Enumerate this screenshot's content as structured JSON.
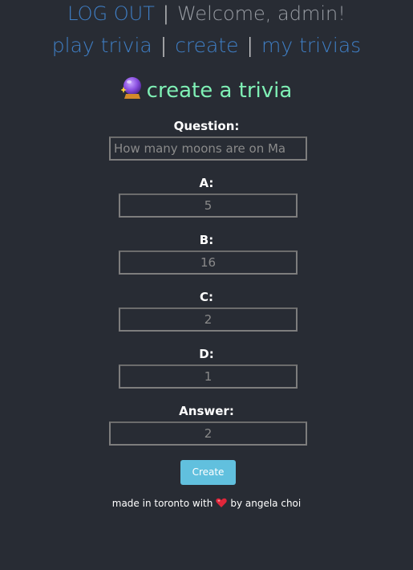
{
  "nav": {
    "logout_label": "LOG OUT",
    "separator": "|",
    "welcome_text": "Welcome, admin!",
    "play_label": "play trivia",
    "create_label": "create",
    "my_trivias_label": "my trivias"
  },
  "page": {
    "title": "create a trivia"
  },
  "form": {
    "question_label": "Question:",
    "question_value": "How many moons are on Ma",
    "a_label": "A:",
    "a_value": "5",
    "b_label": "B:",
    "b_value": "16",
    "c_label": "C:",
    "c_value": "2",
    "d_label": "D:",
    "d_value": "1",
    "answer_label": "Answer:",
    "answer_value": "2",
    "submit_label": "Create"
  },
  "footer": {
    "prefix": "made in toronto with",
    "suffix": "by angela choi"
  },
  "icons": {
    "title_icon": "crystal-ball-icon",
    "footer_icon": "heart-icon"
  },
  "colors": {
    "background": "#282c34",
    "link": "#3f7fc6",
    "title": "#7ff0b5",
    "button": "#61c0de"
  }
}
